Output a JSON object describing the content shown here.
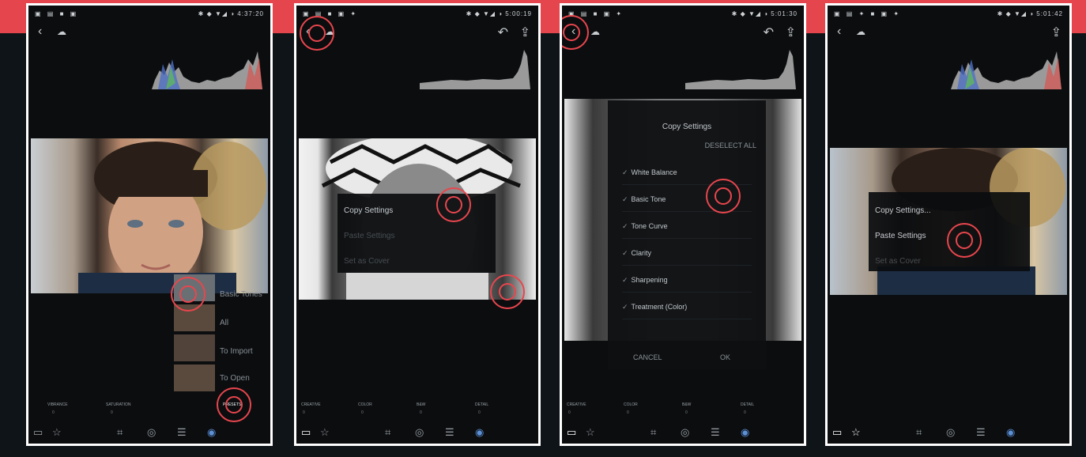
{
  "banner": {
    "color": "#e5454c"
  },
  "panels": [
    {
      "status": {
        "left": "▣ ▤ ■ ▣",
        "right": "✱ ◆ ▼◢ ◑ 4:37:20"
      },
      "presets": [
        "Basic Tones",
        "All",
        "To Import",
        "To Open"
      ],
      "sliders": [
        {
          "label": "VIBRANCE",
          "value": "0"
        },
        {
          "label": "SATURATION",
          "value": "0"
        },
        {
          "label": "",
          "value": ""
        },
        {
          "label": "PRESETS",
          "value": ""
        }
      ]
    },
    {
      "status": {
        "left": "▣ ▤ ■ ▣ ✦",
        "right": "✱ ◆ ▼◢ ◑ 5:00:19"
      },
      "menu": [
        "Copy Settings",
        "Paste Settings",
        "Set as Cover"
      ],
      "sliders": [
        {
          "label": "CREATIVE",
          "value": "0"
        },
        {
          "label": "COLOR",
          "value": "0"
        },
        {
          "label": "B&W",
          "value": "0"
        },
        {
          "label": "DETAIL",
          "value": "0"
        }
      ]
    },
    {
      "status": {
        "left": "▣ ▤ ■ ▣ ✦",
        "right": "✱ ◆ ▼◢ ◑ 5:01:30"
      },
      "dialog": {
        "title": "Copy Settings",
        "deselect": "DESELECT ALL",
        "options": [
          "White Balance",
          "Basic Tone",
          "Tone Curve",
          "Clarity",
          "Sharpening",
          "Treatment (Color)"
        ],
        "cancel": "CANCEL",
        "ok": "OK"
      },
      "sliders": [
        {
          "label": "CREATIVE",
          "value": "0"
        },
        {
          "label": "COLOR",
          "value": "0"
        },
        {
          "label": "B&W",
          "value": "0"
        },
        {
          "label": "DETAIL",
          "value": "0"
        }
      ]
    },
    {
      "status": {
        "left": "▣ ▤ ✦ ■ ▣ ✦",
        "right": "✱ ◆ ▼◢ ◑ 5:01:42"
      },
      "menu": [
        "Copy Settings...",
        "Paste Settings",
        "Set as Cover"
      ]
    }
  ],
  "icons": {
    "back": "‹",
    "cloud": "☁",
    "undo": "↶",
    "share": "⇪",
    "flag": "▭",
    "star": "☆",
    "crop": "⌗",
    "color": "◎",
    "adjust": "☰",
    "presets": "◉"
  },
  "colors": {
    "highlight": "#e8464d",
    "frame": "#ffffff",
    "background": "#0f1418"
  }
}
